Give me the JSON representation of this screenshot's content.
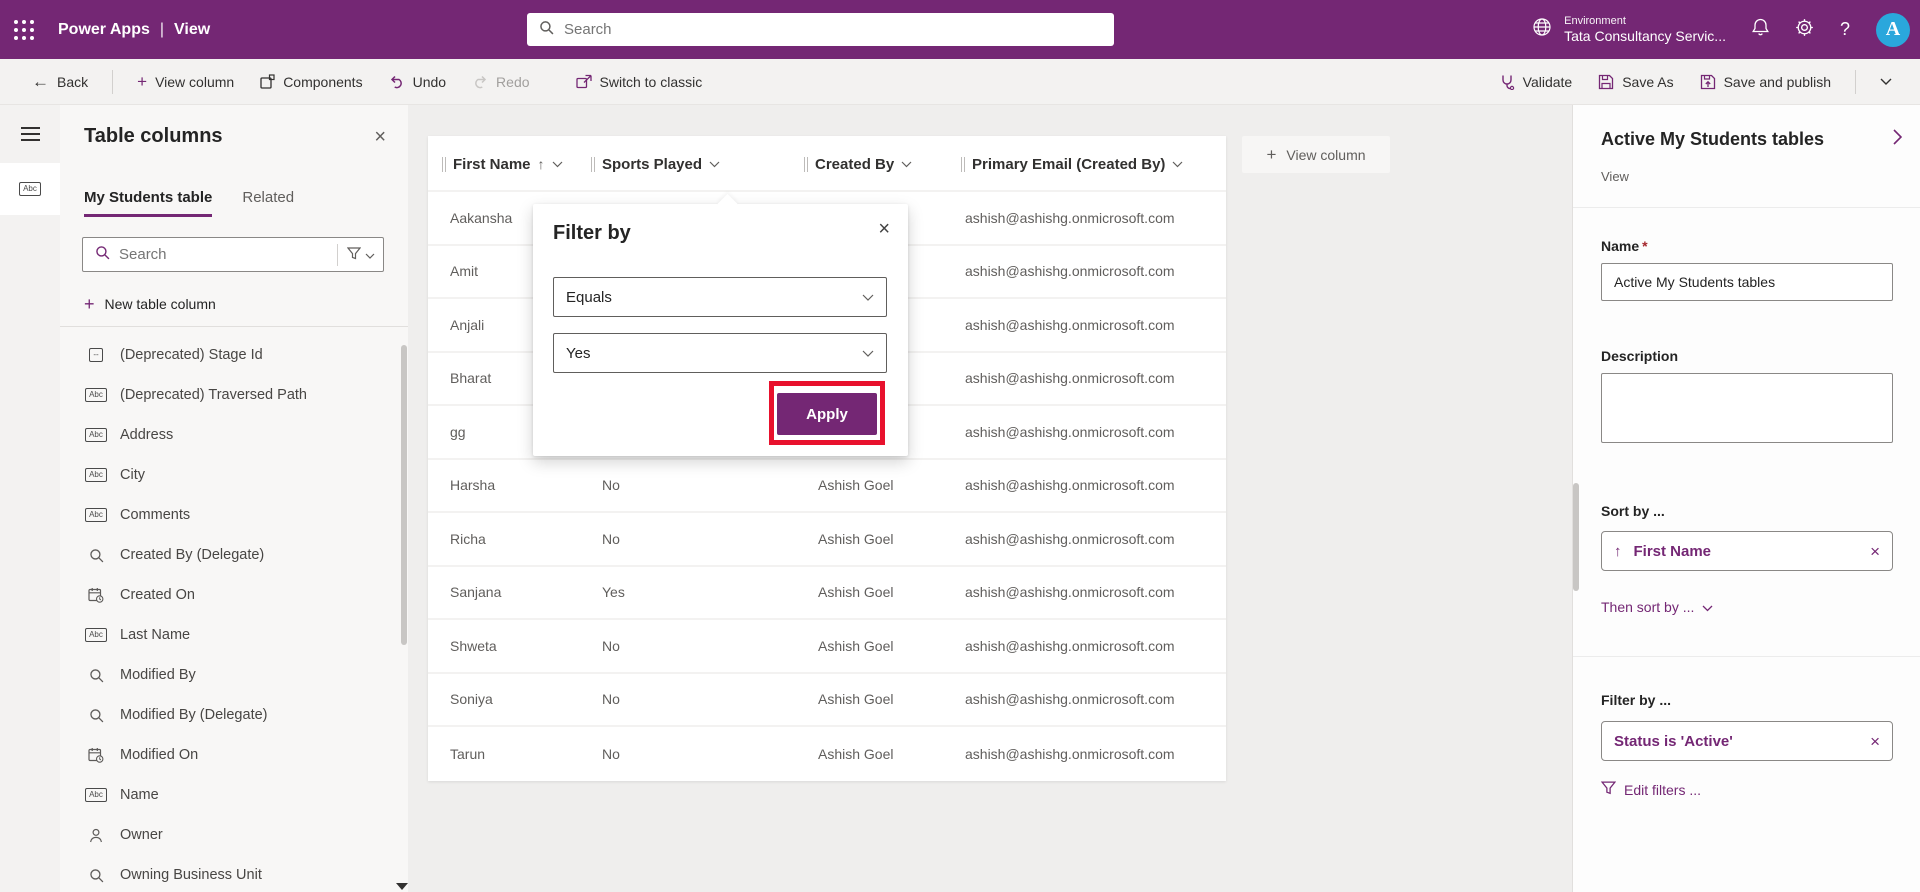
{
  "topbar": {
    "app_title": "Power Apps",
    "separator": "|",
    "page_title": "View",
    "search_placeholder": "Search",
    "environment_label": "Environment",
    "environment_name": "Tata Consultancy Servic...",
    "help_label": "?",
    "avatar_initial": "A"
  },
  "toolbar": {
    "back": "Back",
    "view_column": "View column",
    "components": "Components",
    "undo": "Undo",
    "redo": "Redo",
    "switch_to_classic": "Switch to classic",
    "validate": "Validate",
    "save_as": "Save As",
    "save_and_publish": "Save and publish"
  },
  "left_panel": {
    "title": "Table columns",
    "tabs": [
      {
        "label": "My Students table",
        "active": true
      },
      {
        "label": "Related",
        "active": false
      }
    ],
    "search_placeholder": "Search",
    "new_table_column": "New table column",
    "columns": [
      {
        "icon": "id",
        "label": "(Deprecated) Stage Id"
      },
      {
        "icon": "text",
        "label": "(Deprecated) Traversed Path"
      },
      {
        "icon": "text",
        "label": "Address"
      },
      {
        "icon": "text",
        "label": "City"
      },
      {
        "icon": "text",
        "label": "Comments"
      },
      {
        "icon": "lookup",
        "label": "Created By (Delegate)"
      },
      {
        "icon": "datetime",
        "label": "Created On"
      },
      {
        "icon": "text",
        "label": "Last Name"
      },
      {
        "icon": "lookup",
        "label": "Modified By"
      },
      {
        "icon": "lookup",
        "label": "Modified By (Delegate)"
      },
      {
        "icon": "datetime",
        "label": "Modified On"
      },
      {
        "icon": "text",
        "label": "Name"
      },
      {
        "icon": "person",
        "label": "Owner"
      },
      {
        "icon": "lookup",
        "label": "Owning Business Unit"
      }
    ]
  },
  "grid": {
    "view_column_button": "View column",
    "headers": [
      {
        "label": "First Name",
        "sorted": true
      },
      {
        "label": "Sports Played",
        "sorted": false
      },
      {
        "label": "Created By",
        "sorted": false
      },
      {
        "label": "Primary Email (Created By)",
        "sorted": false
      }
    ],
    "rows": [
      {
        "first_name": "Aakansha",
        "sports_played": "",
        "created_by": "",
        "email": "ashish@ashishg.onmicrosoft.com"
      },
      {
        "first_name": "Amit",
        "sports_played": "",
        "created_by": "",
        "email": "ashish@ashishg.onmicrosoft.com"
      },
      {
        "first_name": "Anjali",
        "sports_played": "",
        "created_by": "",
        "email": "ashish@ashishg.onmicrosoft.com"
      },
      {
        "first_name": "Bharat",
        "sports_played": "",
        "created_by": "",
        "email": "ashish@ashishg.onmicrosoft.com"
      },
      {
        "first_name": "gg",
        "sports_played": "",
        "created_by": "",
        "email": "ashish@ashishg.onmicrosoft.com"
      },
      {
        "first_name": "Harsha",
        "sports_played": "No",
        "created_by": "Ashish Goel",
        "email": "ashish@ashishg.onmicrosoft.com"
      },
      {
        "first_name": "Richa",
        "sports_played": "No",
        "created_by": "Ashish Goel",
        "email": "ashish@ashishg.onmicrosoft.com"
      },
      {
        "first_name": "Sanjana",
        "sports_played": "Yes",
        "created_by": "Ashish Goel",
        "email": "ashish@ashishg.onmicrosoft.com"
      },
      {
        "first_name": "Shweta",
        "sports_played": "No",
        "created_by": "Ashish Goel",
        "email": "ashish@ashishg.onmicrosoft.com"
      },
      {
        "first_name": "Soniya",
        "sports_played": "No",
        "created_by": "Ashish Goel",
        "email": "ashish@ashishg.onmicrosoft.com"
      },
      {
        "first_name": "Tarun",
        "sports_played": "No",
        "created_by": "Ashish Goel",
        "email": "ashish@ashishg.onmicrosoft.com"
      }
    ]
  },
  "filter_dialog": {
    "title": "Filter by",
    "operator_value": "Equals",
    "value_value": "Yes",
    "apply_label": "Apply"
  },
  "right_panel": {
    "title": "Active My Students tables",
    "subtitle": "View",
    "name_label": "Name",
    "required_mark": "*",
    "name_value": "Active My Students tables",
    "description_label": "Description",
    "sort_section_label": "Sort by ...",
    "sort_chip_label": "First Name",
    "then_sort_label": "Then sort by ...",
    "filter_section_label": "Filter by ...",
    "filter_chip_label": "Status is 'Active'",
    "edit_filters_label": "Edit filters ..."
  },
  "icons": {
    "waffle": "3x3-dot-grid",
    "search": "magnifier",
    "environment": "globe",
    "notifications": "bell",
    "settings": "gear",
    "help": "question-mark",
    "back": "left-arrow",
    "add": "plus",
    "components": "nested-squares",
    "undo": "counterclockwise-arrow",
    "redo": "clockwise-arrow",
    "switch_classic": "window-with-arrow",
    "validate": "stethoscope",
    "save_as": "floppy-disk",
    "save_and_publish": "floppy-with-arrow",
    "close": "x",
    "filter": "funnel",
    "column_text": "abc-box",
    "column_id": "dash-box",
    "column_lookup": "magnifier",
    "column_datetime": "calendar-clock",
    "column_person": "person-silhouette",
    "sort_ascending": "up-arrow",
    "chevron_down": "chevron-down",
    "chevron_right": "chevron-right"
  },
  "colors": {
    "brand_purple": "#742774",
    "highlight_red": "#e8112d",
    "avatar_cyan": "#2aa7dc",
    "canvas_gray": "#efeeed",
    "toolbar_gray": "#f3f2f1"
  }
}
